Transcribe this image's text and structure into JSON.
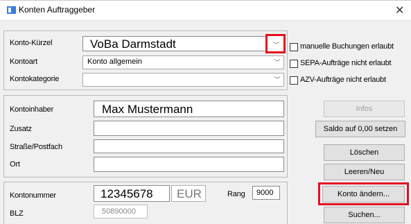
{
  "window": {
    "title": "Konten Auftraggeber",
    "close_icon": "close-icon"
  },
  "top": {
    "konto_kuerzel_label": "Konto-Kürzel",
    "konto_kuerzel_value": "VoBa Darmstadt",
    "kontoart_label": "Kontoart",
    "kontoart_value": "Konto allgemein",
    "kontokategorie_label": "Kontokategorie",
    "kontokategorie_value": ""
  },
  "checkboxes": {
    "manuelle": "manuelle Buchungen erlaubt",
    "sepa": "SEPA-Aufträge nicht erlaubt",
    "azv": "AZV-Aufträge nicht erlaubt"
  },
  "owner": {
    "kontoinhaber_label": "Kontoinhaber",
    "kontoinhaber_value": "Max Mustermann",
    "zusatz_label": "Zusatz",
    "strasse_label": "Straße/Postfach",
    "ort_label": "Ort"
  },
  "account": {
    "kontonummer_label": "Kontonummer",
    "kontonummer_value": "12345678",
    "currency_value": "EUR",
    "rang_label": "Rang",
    "rang_value": "9000",
    "blz_label": "BLZ",
    "blz_value": "50890000"
  },
  "buttons": {
    "infos": "Infos",
    "saldo": "Saldo auf 0,00 setzen",
    "loeschen": "Löschen",
    "leeren": "Leeren/Neu",
    "konto_aendern": "Konto ändern...",
    "suchen": "Suchen..."
  },
  "colors": {
    "highlight": "#e3101f",
    "background": "#f0f0f0"
  }
}
